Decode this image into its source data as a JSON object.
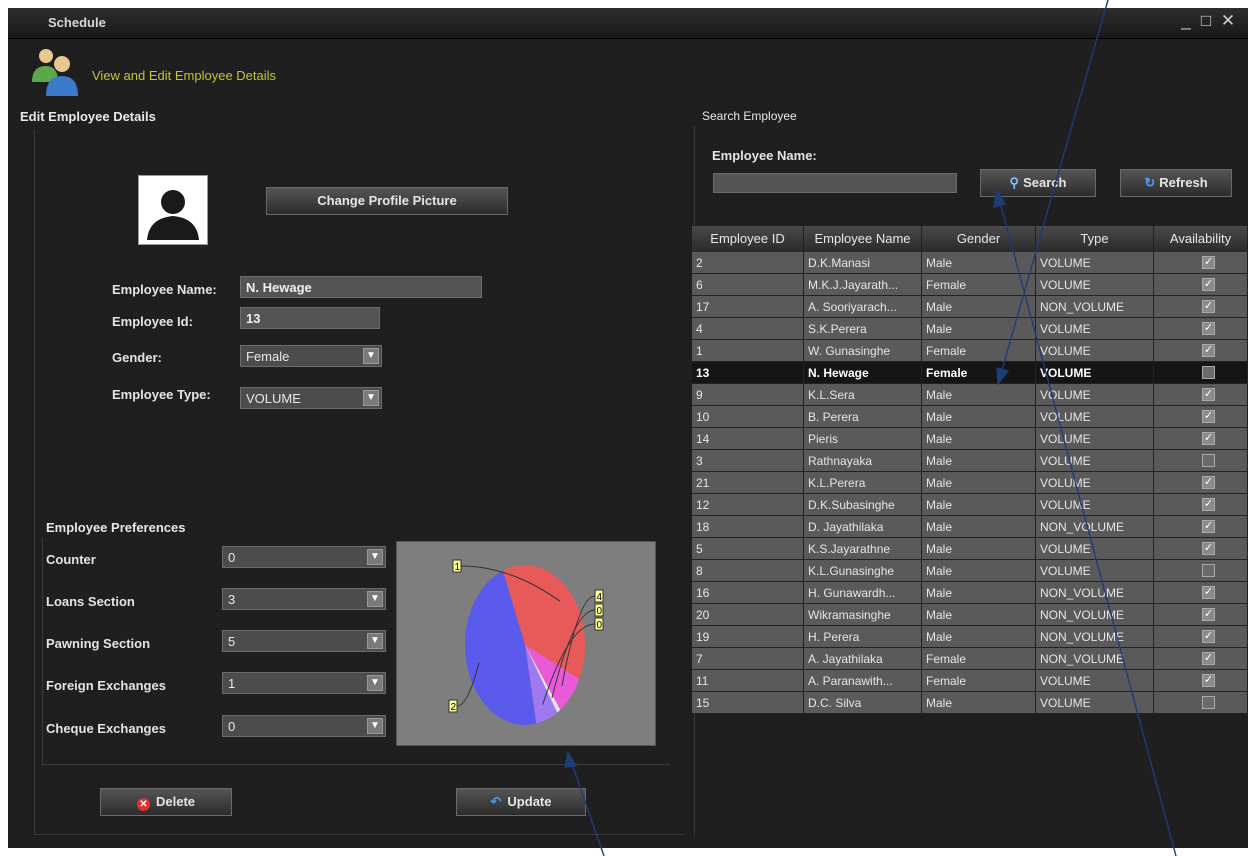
{
  "window": {
    "title": "Schedule",
    "controls": [
      "_",
      "□",
      "✕"
    ]
  },
  "banner": {
    "title": "View and Edit Employee Details",
    "icon": "people-icon"
  },
  "edit_panel": {
    "title": "Edit Employee Details",
    "change_picture_label": "Change Profile Picture",
    "fields": {
      "name_label": "Employee Name:",
      "name_value": "N. Hewage",
      "id_label": "Employee Id:",
      "id_value": "13",
      "gender_label": "Gender:",
      "gender_value": "Female",
      "type_label": "Employee Type:",
      "type_value": "VOLUME"
    }
  },
  "preferences": {
    "title": "Employee Preferences",
    "items": [
      {
        "label": "Counter",
        "value": "0"
      },
      {
        "label": "Loans Section",
        "value": "3"
      },
      {
        "label": "Pawning Section",
        "value": "5"
      },
      {
        "label": "Foreign Exchanges",
        "value": "1"
      },
      {
        "label": "Cheque Exchanges",
        "value": "0"
      }
    ],
    "chart_data": {
      "type": "pie",
      "labels": [
        "1",
        "4",
        "0",
        "0",
        "2"
      ],
      "values": [
        38,
        8,
        1,
        6,
        47
      ],
      "colors": [
        "#e85a5a",
        "#e85ad8",
        "#e6e6e6",
        "#a078f0",
        "#5a5aec"
      ]
    }
  },
  "actions": {
    "delete_label": "Delete",
    "update_label": "Update"
  },
  "search": {
    "title": "Search Employee",
    "name_label": "Employee Name:",
    "search_label": "Search",
    "refresh_label": "Refresh"
  },
  "table": {
    "columns": [
      "Employee ID",
      "Employee Name",
      "Gender",
      "Type",
      "Availability"
    ],
    "selected_index": 5,
    "rows": [
      {
        "id": "2",
        "name": "D.K.Manasi",
        "gender": "Male",
        "type": "VOLUME",
        "avail": true
      },
      {
        "id": "6",
        "name": "M.K.J.Jayarath...",
        "gender": "Female",
        "type": "VOLUME",
        "avail": true
      },
      {
        "id": "17",
        "name": "A. Sooriyarach...",
        "gender": "Male",
        "type": "NON_VOLUME",
        "avail": true
      },
      {
        "id": "4",
        "name": "S.K.Perera",
        "gender": "Male",
        "type": "VOLUME",
        "avail": true
      },
      {
        "id": "1",
        "name": "W. Gunasinghe",
        "gender": "Female",
        "type": "VOLUME",
        "avail": true
      },
      {
        "id": "13",
        "name": "N. Hewage",
        "gender": "Female",
        "type": "VOLUME",
        "avail": false
      },
      {
        "id": "9",
        "name": "K.L.Sera",
        "gender": "Male",
        "type": "VOLUME",
        "avail": true
      },
      {
        "id": "10",
        "name": "B. Perera",
        "gender": "Male",
        "type": "VOLUME",
        "avail": true
      },
      {
        "id": "14",
        "name": "Pieris",
        "gender": "Male",
        "type": "VOLUME",
        "avail": true
      },
      {
        "id": "3",
        "name": "Rathnayaka",
        "gender": "Male",
        "type": "VOLUME",
        "avail": false
      },
      {
        "id": "21",
        "name": "K.L.Perera",
        "gender": "Male",
        "type": "VOLUME",
        "avail": true
      },
      {
        "id": "12",
        "name": "D.K.Subasinghe",
        "gender": "Male",
        "type": "VOLUME",
        "avail": true
      },
      {
        "id": "18",
        "name": "D. Jayathilaka",
        "gender": "Male",
        "type": "NON_VOLUME",
        "avail": true
      },
      {
        "id": "5",
        "name": "K.S.Jayarathne",
        "gender": "Male",
        "type": "VOLUME",
        "avail": true
      },
      {
        "id": "8",
        "name": "K.L.Gunasinghe",
        "gender": "Male",
        "type": "VOLUME",
        "avail": false
      },
      {
        "id": "16",
        "name": "H. Gunawardh...",
        "gender": "Male",
        "type": "NON_VOLUME",
        "avail": true
      },
      {
        "id": "20",
        "name": "Wikramasinghe",
        "gender": "Male",
        "type": "NON_VOLUME",
        "avail": true
      },
      {
        "id": "19",
        "name": "H. Perera",
        "gender": "Male",
        "type": "NON_VOLUME",
        "avail": true
      },
      {
        "id": "7",
        "name": "A. Jayathilaka",
        "gender": "Female",
        "type": "NON_VOLUME",
        "avail": true
      },
      {
        "id": "11",
        "name": "A. Paranawith...",
        "gender": "Female",
        "type": "VOLUME",
        "avail": true
      },
      {
        "id": "15",
        "name": "D.C. Silva",
        "gender": "Male",
        "type": "VOLUME",
        "avail": false
      }
    ]
  }
}
